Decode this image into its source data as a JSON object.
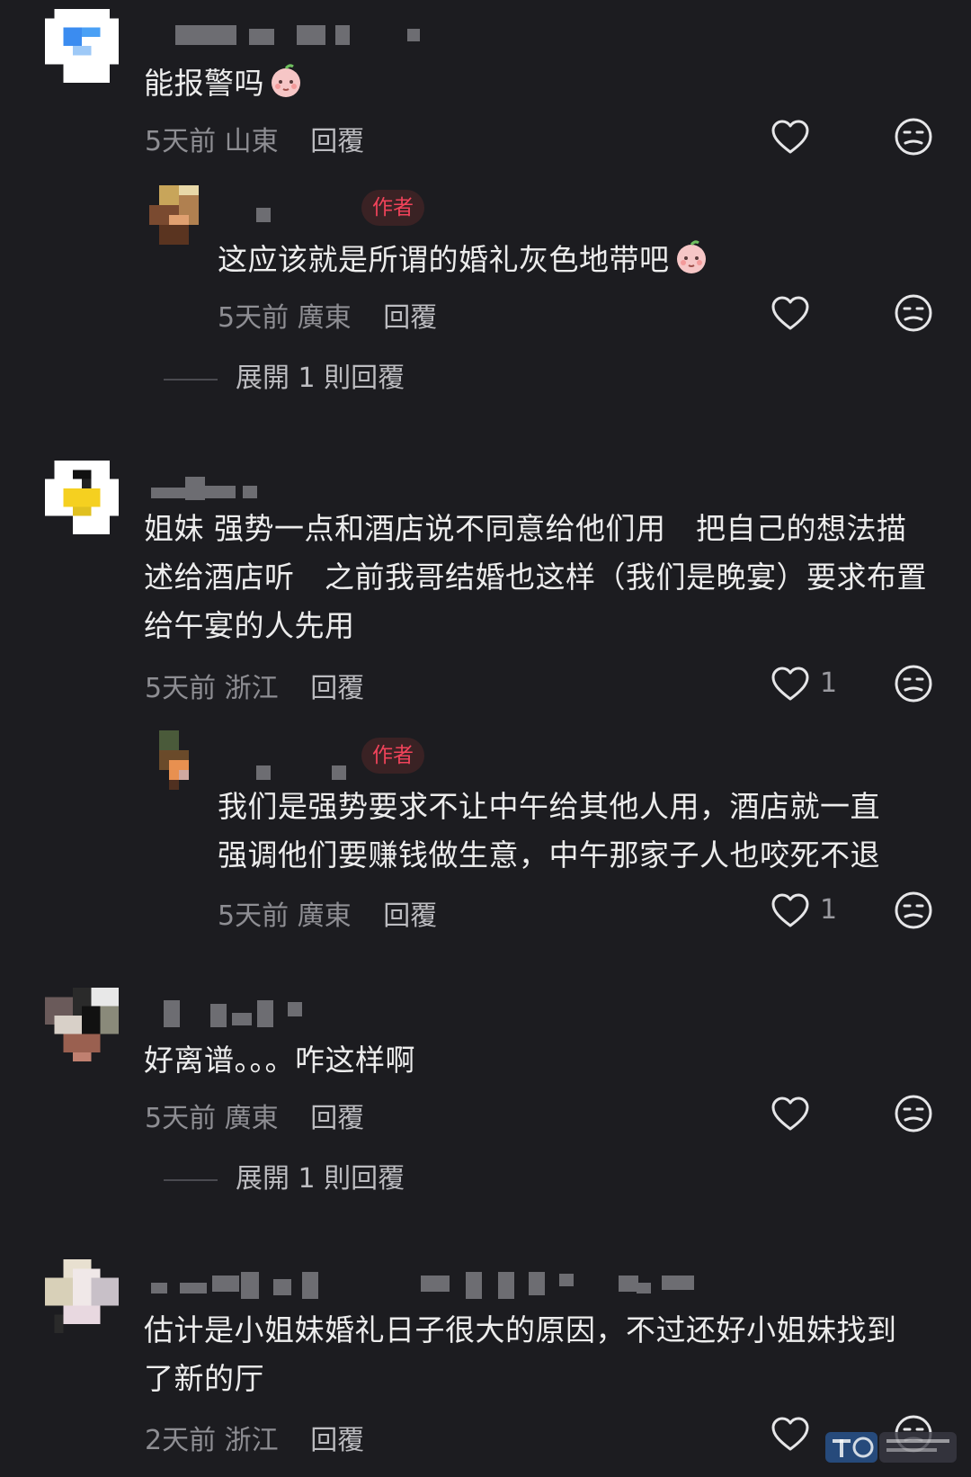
{
  "comments": [
    {
      "text": "能报警吗",
      "time": "5天前",
      "location": "山東",
      "reply": "回覆",
      "likes": ""
    },
    {
      "badge": "作者",
      "text": "这应该就是所谓的婚礼灰色地带吧",
      "time": "5天前",
      "location": "廣東",
      "reply": "回覆",
      "likes": ""
    },
    {
      "text": "姐妹 强势一点和酒店说不同意给他们用　把自己的想法描\n述给酒店听　之前我哥结婚也这样（我们是晚宴）要求布置\n给午宴的人先用",
      "time": "5天前",
      "location": "浙江",
      "reply": "回覆",
      "likes": "1"
    },
    {
      "badge": "作者",
      "text": "我们是强势要求不让中午给其他人用，酒店就一直\n强调他们要赚钱做生意，中午那家子人也咬死不退",
      "time": "5天前",
      "location": "廣東",
      "reply": "回覆",
      "likes": "1"
    },
    {
      "text": "好离谱。。。咋这样啊",
      "time": "5天前",
      "location": "廣東",
      "reply": "回覆",
      "likes": ""
    },
    {
      "text": "估计是小姐妹婚礼日子很大的原因，不过还好小姐妹找到\n了新的厅",
      "time": "2天前",
      "location": "浙江",
      "reply": "回覆",
      "likes": ""
    }
  ],
  "expand_replies": [
    {
      "label": "展開 1 則回覆"
    },
    {
      "label": "展開 1 則回覆"
    }
  ],
  "icons": {
    "like": "heart-outline-icon",
    "dislike": "meh-face-icon",
    "emoji": "baby-face-emoji"
  },
  "colors": {
    "background": "#1c1c20",
    "author_badge": "#f0435a"
  }
}
